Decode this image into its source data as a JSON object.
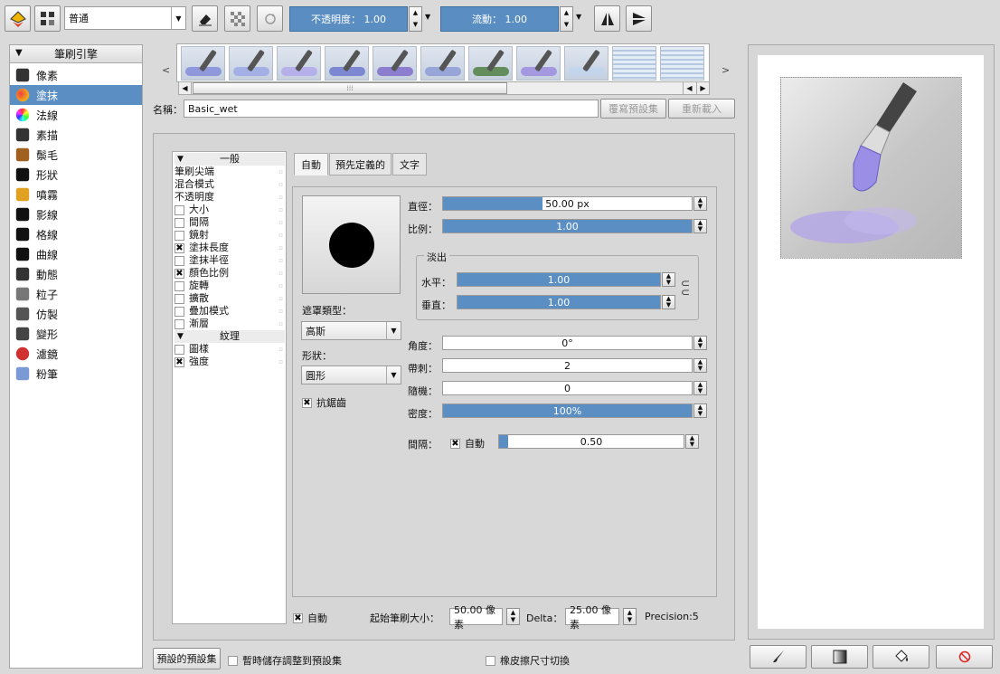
{
  "toolbar": {
    "blend_mode": "普通",
    "opacity": "不透明度： 1.00",
    "flow": "流動： 1.00",
    "icons": [
      "color-palette-icon",
      "brush-presets-icon",
      "eraser-icon",
      "transparency-icon",
      "reload-icon",
      "mirror-horizontal-icon",
      "mirror-vertical-icon"
    ]
  },
  "engines": {
    "header": "筆刷引擎",
    "items": [
      {
        "label": "像素",
        "icon": "pixel-brush-icon"
      },
      {
        "label": "塗抹",
        "icon": "smudge-brush-icon"
      },
      {
        "label": "法線",
        "icon": "normal-brush-icon"
      },
      {
        "label": "素描",
        "icon": "sketch-brush-icon"
      },
      {
        "label": "鬃毛",
        "icon": "bristle-brush-icon"
      },
      {
        "label": "形狀",
        "icon": "shape-brush-icon"
      },
      {
        "label": "噴霧",
        "icon": "spray-brush-icon"
      },
      {
        "label": "影線",
        "icon": "hatching-brush-icon"
      },
      {
        "label": "格線",
        "icon": "grid-brush-icon"
      },
      {
        "label": "曲線",
        "icon": "curve-brush-icon"
      },
      {
        "label": "動態",
        "icon": "dynamic-brush-icon"
      },
      {
        "label": "粒子",
        "icon": "particle-brush-icon"
      },
      {
        "label": "仿製",
        "icon": "clone-brush-icon"
      },
      {
        "label": "變形",
        "icon": "deform-brush-icon"
      },
      {
        "label": "濾鏡",
        "icon": "filter-brush-icon"
      },
      {
        "label": "粉筆",
        "icon": "chalk-brush-icon"
      }
    ]
  },
  "presets": {
    "prev": "<",
    "next": ">",
    "name_label": "名稱：",
    "name_value": "Basic_wet",
    "overwrite": "覆寫預設集",
    "reload": "重新載入"
  },
  "props": {
    "general_header": "一般",
    "items": [
      {
        "label": "筆刷尖端",
        "check": null
      },
      {
        "label": "混合模式",
        "check": null
      },
      {
        "label": "不透明度",
        "check": null
      },
      {
        "label": "大小",
        "check": false
      },
      {
        "label": "間隔",
        "check": false
      },
      {
        "label": "鏡射",
        "check": false
      },
      {
        "label": "塗抹長度",
        "check": true
      },
      {
        "label": "塗抹半徑",
        "check": false
      },
      {
        "label": "顏色比例",
        "check": true
      },
      {
        "label": "旋轉",
        "check": false
      },
      {
        "label": "擴散",
        "check": false
      },
      {
        "label": "疊加模式",
        "check": false
      },
      {
        "label": "漸層",
        "check": false
      }
    ],
    "texture_header": "紋理",
    "texture_items": [
      {
        "label": "圖樣",
        "check": false
      },
      {
        "label": "強度",
        "check": true
      }
    ]
  },
  "tabs": [
    "自動",
    "預先定義的",
    "文字"
  ],
  "tip": {
    "mask_type_label": "遮罩類型：",
    "mask_type": "高斯",
    "shape_label": "形狀：",
    "shape": "圓形",
    "antialias": "抗鋸齒",
    "diameter_label": "直徑：",
    "diameter": "50.00 px",
    "diameter_frac": 0.4,
    "ratio_label": "比例：",
    "ratio": "1.00",
    "ratio_frac": 1.0,
    "fade_label": "淡出",
    "horizontal_label": "水平：",
    "horizontal": "1.00",
    "vertical_label": "垂直：",
    "vertical": "1.00",
    "angle_label": "角度：",
    "angle": "0°",
    "angle_frac": 0.0,
    "spikes_label": "帶刺：",
    "spikes": "2",
    "spikes_frac": 0.0,
    "random_label": "隨機：",
    "random": "0",
    "random_frac": 0.0,
    "density_label": "密度：",
    "density": "100%",
    "density_frac": 1.0,
    "spacing_label": "間隔：",
    "spacing_auto": "自動",
    "spacing": "0.50",
    "spacing_frac": 0.05
  },
  "bottom": {
    "auto": "自動",
    "start_size_label": "起始筆刷大小：",
    "start_size": "50.00 像素",
    "delta_label": "Delta：",
    "delta": "25.00 像素",
    "precision": "Precision:5",
    "predefined_presets": "預設的預設集",
    "temp_save": "暫時儲存調整到預設集",
    "eraser_toggle": "橡皮擦尺寸切換"
  },
  "colors": {
    "accent": "#5b8fc4",
    "panel": "#dadada"
  }
}
